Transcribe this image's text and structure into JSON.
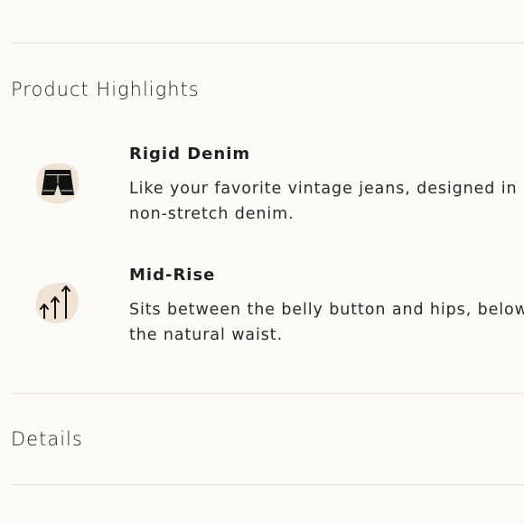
{
  "sections": {
    "product_highlights": {
      "heading": "Product Highlights"
    },
    "details": {
      "heading": "Details"
    }
  },
  "highlights": [
    {
      "icon": "denim-shorts-icon",
      "title": "Rigid Denim",
      "description_lines": [
        "Like your favorite vintage jeans, designed in",
        "non-stretch denim."
      ]
    },
    {
      "icon": "rise-arrows-icon",
      "title": "Mid-Rise",
      "description_lines": [
        "Sits between the belly button and hips, below",
        "the natural waist."
      ]
    }
  ],
  "colors": {
    "background": "#fdfbf8",
    "icon_blob": "#efe3d6",
    "divider": "#e8e2d8",
    "text": "#1f1f1f"
  }
}
